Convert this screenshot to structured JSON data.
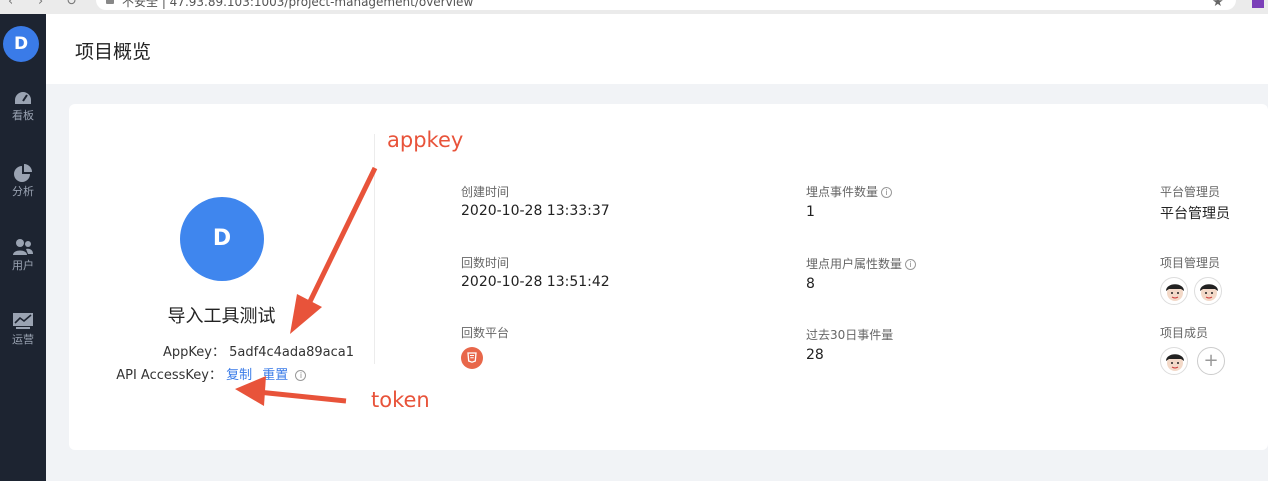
{
  "browser": {
    "url": "不安全 | 47.93.89.103:1003/project-management/overview",
    "star_icon": "star-icon"
  },
  "sidebar": {
    "avatar_letter": "D",
    "items": [
      {
        "label": "看板",
        "icon": "dashboard-icon"
      },
      {
        "label": "分析",
        "icon": "pie-chart-icon"
      },
      {
        "label": "用户",
        "icon": "users-icon"
      },
      {
        "label": "运营",
        "icon": "monitor-chart-icon"
      }
    ]
  },
  "header": {
    "title": "项目概览"
  },
  "project": {
    "avatar_letter": "D",
    "name": "导入工具测试",
    "appkey_label": "AppKey：",
    "appkey_value": "5adf4c4ada89aca1",
    "accesskey_label": "API AccessKey：",
    "copy_label": "复制",
    "reset_label": "重置"
  },
  "stats": {
    "created_label": "创建时间",
    "created_value": "2020-10-28 13:33:37",
    "callback_label": "回数时间",
    "callback_value": "2020-10-28 13:51:42",
    "platform_label": "回数平台",
    "platform_icon": "html5-icon",
    "event_count_label": "埋点事件数量",
    "event_count_value": "1",
    "user_prop_label": "埋点用户属性数量",
    "user_prop_value": "8",
    "events_30d_label": "过去30日事件量",
    "events_30d_value": "28",
    "platform_admin_label": "平台管理员",
    "platform_admin_value": "平台管理员",
    "project_admin_label": "项目管理员",
    "project_member_label": "项目成员"
  },
  "annotations": {
    "appkey": "appkey",
    "token": "token",
    "color": "#e8533a"
  }
}
